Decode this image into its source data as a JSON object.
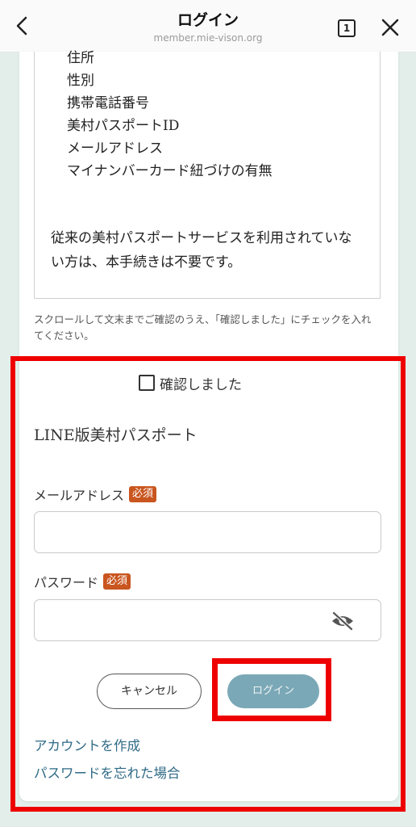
{
  "browser": {
    "title": "ログイン",
    "url": "member.mie-vison.org",
    "tab_count": "1"
  },
  "terms": {
    "items": [
      "住所",
      "性別",
      "携帯電話番号",
      "美村パスポートID",
      "メールアドレス",
      "マイナンバーカード紐づけの有無"
    ],
    "note": "従来の美村パスポートサービスを利用されていない方は、本手続きは不要です。",
    "scroll_hint": "スクロールして文末までご確認のうえ、「確認しました」にチェックを入れてください。"
  },
  "form": {
    "confirm_label": "確認しました",
    "confirm_checked": false,
    "section_title": "LINE版美村パスポート",
    "email_label": "メールアドレス",
    "password_label": "パスワード",
    "required_badge": "必須",
    "email_value": "",
    "password_value": "",
    "cancel_label": "キャンセル",
    "login_label": "ログイン",
    "create_account_link": "アカウントを作成",
    "forgot_password_link": "パスワードを忘れた場合"
  },
  "colors": {
    "login_button": "#7ba8b6",
    "required_badge": "#c9551f",
    "link": "#2f6a86",
    "highlight": "#ee0000",
    "background": "#e3eeea"
  }
}
